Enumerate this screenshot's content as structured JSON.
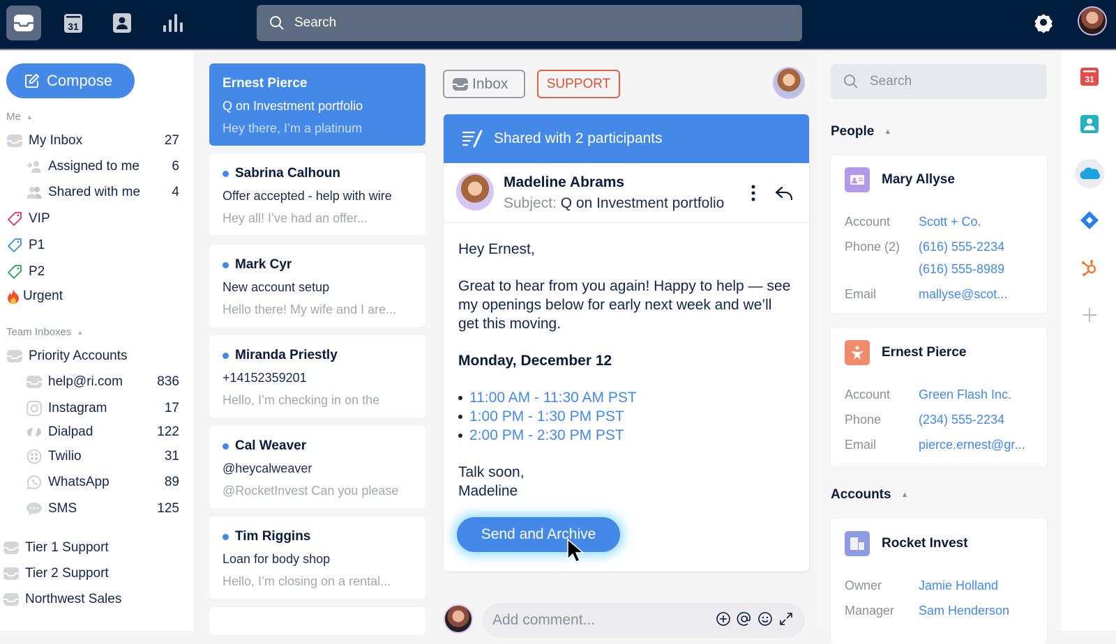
{
  "topbar": {
    "nav_icons": [
      "inbox-icon",
      "calendar-icon",
      "contacts-icon",
      "analytics-icon"
    ],
    "calendar_day": "31",
    "search_placeholder": "Search"
  },
  "sidebar": {
    "compose_label": "Compose",
    "me_label": "Me",
    "me_items": [
      {
        "label": "My Inbox",
        "count": "27",
        "icon": "inbox-icon"
      },
      {
        "label": "Assigned to me",
        "count": "6",
        "icon": "assigned-icon"
      },
      {
        "label": "Shared with me",
        "count": "4",
        "icon": "shared-icon"
      }
    ],
    "tags": [
      {
        "label": "VIP",
        "color": "#d6336c"
      },
      {
        "label": "P1",
        "color": "#3a8dd8"
      },
      {
        "label": "P2",
        "color": "#2f9e5a"
      },
      {
        "label": "Urgent",
        "icon": "fire-icon"
      }
    ],
    "team_label": "Team Inboxes",
    "priority_accounts": "Priority Accounts",
    "channels": [
      {
        "label": "help@ri.com",
        "count": "836",
        "icon": "inbox-icon"
      },
      {
        "label": "Instagram",
        "count": "17",
        "icon": "instagram-icon"
      },
      {
        "label": "Dialpad",
        "count": "122",
        "icon": "dialpad-icon"
      },
      {
        "label": "Twilio",
        "count": "31",
        "icon": "twilio-icon"
      },
      {
        "label": "WhatsApp",
        "count": "89",
        "icon": "whatsapp-icon"
      },
      {
        "label": "SMS",
        "count": "125",
        "icon": "sms-icon"
      }
    ],
    "other_inboxes": [
      "Tier 1 Support",
      "Tier 2 Support",
      "Northwest Sales"
    ]
  },
  "conversations": [
    {
      "name": "Ernest Pierce",
      "subject": "Q on Investment portfolio",
      "preview": "Hey there, I’m a platinum",
      "unread": false,
      "active": true
    },
    {
      "name": "Sabrina Calhoun",
      "subject": "Offer accepted - help with wire",
      "preview": "Hey all! I’ve had an offer...",
      "unread": true
    },
    {
      "name": "Mark Cyr",
      "subject": "New account setup",
      "preview": "Hello there! My wife and I are...",
      "unread": true
    },
    {
      "name": "Miranda Priestly",
      "subject": "+14152359201",
      "preview": "Hello, I’m checking in on the",
      "unread": true
    },
    {
      "name": "Cal Weaver",
      "subject": "@heycalweaver",
      "preview": "@RocketInvest Can you please",
      "unread": true
    },
    {
      "name": "Tim Riggins",
      "subject": "Loan for body shop",
      "preview": "Hello, I’m closing on a rental...",
      "unread": true
    }
  ],
  "thread": {
    "inbox_chip": "Inbox",
    "tag_chip": "SUPPORT",
    "shared_banner": "Shared with 2 participants",
    "from": "Madeline Abrams",
    "subject_label": "Subject:",
    "subject": "Q on Investment portfolio",
    "greeting": "Hey Ernest,",
    "paragraph": "Great to hear from you again! Happy to help — see my openings below for early next week and we’ll get this moving.",
    "day": "Monday, December 12",
    "slots": [
      "11:00 AM - 11:30 AM PST",
      "1:00 PM - 1:30 PM PST",
      "2:00 PM - 2:30 PM PST"
    ],
    "signoff": "Talk soon,",
    "signature": "Madeline",
    "send_button": "Send and Archive",
    "comment_placeholder": "Add comment..."
  },
  "contacts": {
    "search_placeholder": "Search",
    "people_label": "People",
    "people": [
      {
        "name": "Mary Allyse",
        "badge_color": "#b39ae8",
        "fields": [
          {
            "key": "Account",
            "value": "Scott + Co."
          },
          {
            "key": "Phone (2)",
            "value": "(616) 555-2234"
          },
          {
            "key": "",
            "value": "(616) 555-8989"
          },
          {
            "key": "Email",
            "value": "mallyse@scot..."
          }
        ]
      },
      {
        "name": "Ernest Pierce",
        "badge_color": "#f08a68",
        "fields": [
          {
            "key": "Account",
            "value": "Green Flash Inc."
          },
          {
            "key": "Phone",
            "value": "(234) 555-2234"
          },
          {
            "key": "Email",
            "value": "pierce.ernest@gr..."
          }
        ]
      }
    ],
    "accounts_label": "Accounts",
    "accounts": [
      {
        "name": "Rocket Invest",
        "badge_color": "#8e9be3",
        "fields": [
          {
            "key": "Owner",
            "value": "Jamie Holland"
          },
          {
            "key": "Manager",
            "value": "Sam Henderson"
          }
        ]
      }
    ]
  },
  "rail": {
    "apps": [
      "calendar-app-icon",
      "contacts-app-icon",
      "salesforce-icon",
      "jira-icon",
      "hubspot-icon",
      "add-app-icon"
    ],
    "calendar_day": "31"
  },
  "colors": {
    "accent": "#4589e8",
    "topbar": "#001d3d",
    "support": "#d9532f"
  }
}
